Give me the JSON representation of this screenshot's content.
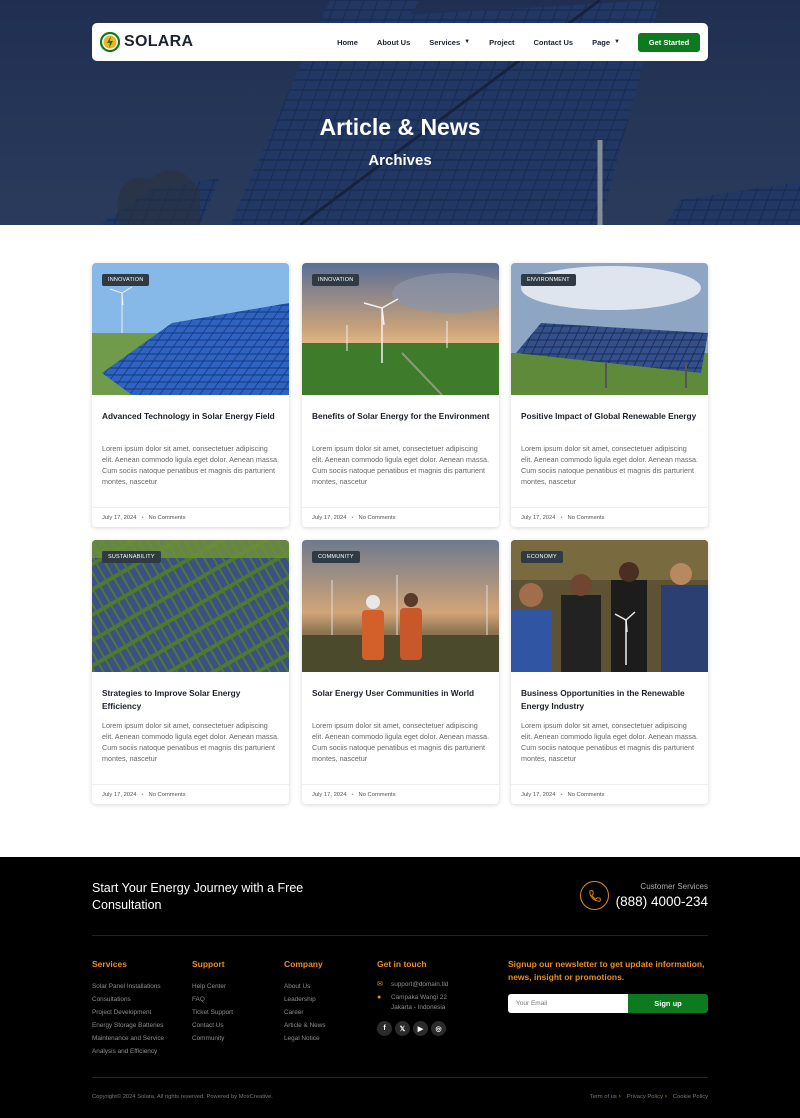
{
  "brand": {
    "name": "SOLARA",
    "accent": "#0d7a1f",
    "secondary": "#f08c1e"
  },
  "nav": {
    "items": [
      {
        "label": "Home"
      },
      {
        "label": "About Us"
      },
      {
        "label": "Services",
        "dropdown": true
      },
      {
        "label": "Project"
      },
      {
        "label": "Contact Us"
      },
      {
        "label": "Page",
        "dropdown": true
      }
    ],
    "cta": "Get Started"
  },
  "hero": {
    "title": "Article & News",
    "subtitle": "Archives"
  },
  "posts": [
    {
      "category": "INNOVATION",
      "title": "Advanced Technology in Solar Energy Field",
      "excerpt": "Lorem ipsum dolor sit amet, consectetuer adipiscing elit. Aenean commodo ligula eget dolor. Aenean massa. Cum sociis natoque penatibus et magnis dis parturient montes, nascetur",
      "date": "July 17, 2024",
      "comments": "No Comments"
    },
    {
      "category": "INNOVATION",
      "title": "Benefits of Solar Energy for the Environment",
      "excerpt": "Lorem ipsum dolor sit amet, consectetuer adipiscing elit. Aenean commodo ligula eget dolor. Aenean massa. Cum sociis natoque penatibus et magnis dis parturient montes, nascetur",
      "date": "July 17, 2024",
      "comments": "No Comments"
    },
    {
      "category": "ENVIRONMENT",
      "title": "Positive Impact of Global Renewable Energy",
      "excerpt": "Lorem ipsum dolor sit amet, consectetuer adipiscing elit. Aenean commodo ligula eget dolor. Aenean massa. Cum sociis natoque penatibus et magnis dis parturient montes, nascetur",
      "date": "July 17, 2024",
      "comments": "No Comments"
    },
    {
      "category": "SUSTAINABILITY",
      "title": "Strategies to Improve Solar Energy Efficiency",
      "excerpt": "Lorem ipsum dolor sit amet, consectetuer adipiscing elit. Aenean commodo ligula eget dolor. Aenean massa. Cum sociis natoque penatibus et magnis dis parturient montes, nascetur",
      "date": "July 17, 2024",
      "comments": "No Comments"
    },
    {
      "category": "COMMUNITY",
      "title": "Solar Energy User Communities in World",
      "excerpt": "Lorem ipsum dolor sit amet, consectetuer adipiscing elit. Aenean commodo ligula eget dolor. Aenean massa. Cum sociis natoque penatibus et magnis dis parturient montes, nascetur",
      "date": "July 17, 2024",
      "comments": "No Comments"
    },
    {
      "category": "ECONOMY",
      "title": "Business Opportunities in the Renewable Energy Industry",
      "excerpt": "Lorem ipsum dolor sit amet, consectetuer adipiscing elit. Aenean commodo ligula eget dolor. Aenean massa. Cum sociis natoque penatibus et magnis dis parturient montes, nascetur",
      "date": "July 17, 2024",
      "comments": "No Comments"
    }
  ],
  "footer": {
    "cta": "Start Your Energy Journey with a Free Consultation",
    "customer_label": "Customer Services",
    "phone": "(888) 4000-234",
    "services": {
      "title": "Services",
      "links": [
        "Solar Panel Installations",
        "Consultations",
        "Project Development",
        "Energy Storage Batteries",
        "Maintenance and Service",
        "Analysis and Efficiency"
      ]
    },
    "support": {
      "title": "Support",
      "links": [
        "Help Center",
        "FAQ",
        "Ticket Support",
        "Contact Us",
        "Community"
      ]
    },
    "company": {
      "title": "Company",
      "links": [
        "About Us",
        "Leadership",
        "Career",
        "Article & News",
        "Legal Notice"
      ]
    },
    "contact": {
      "title": "Get in touch",
      "email": "support@domain.tld",
      "address_line1": "Campaka Wangi 22",
      "address_line2": "Jakarta - Indonesia",
      "socials": [
        "facebook-icon",
        "twitter-icon",
        "youtube-icon",
        "instagram-icon"
      ]
    },
    "newsletter": {
      "title": "Signup our newsletter to get update information, news, insight or promotions.",
      "placeholder": "Your Email",
      "button": "Sign up"
    },
    "copyright": "Copyright© 2024 Solara, All rights reserved. Powered by MoxCreative.",
    "legal": [
      "Term of us",
      "Privacy Policy",
      "Cookie Policy"
    ]
  }
}
